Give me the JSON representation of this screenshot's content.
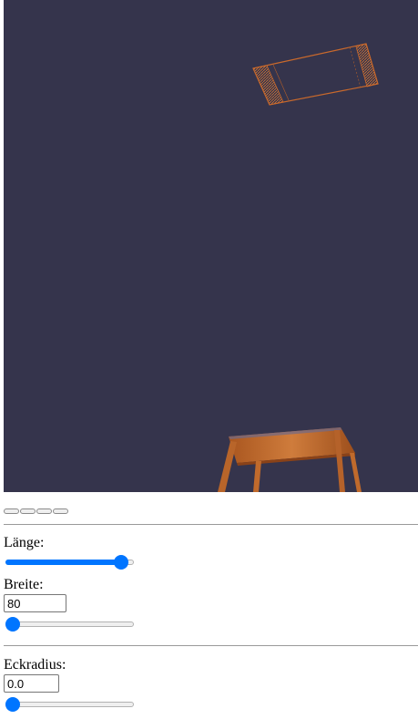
{
  "colors": {
    "scene_background": "#35344c",
    "accent": "#0075ff",
    "wood": "#c06a2c",
    "separator": "#9a9a9a"
  },
  "toolbar": {
    "buttons": [
      "",
      "",
      "",
      ""
    ]
  },
  "controls": {
    "laenge": {
      "label": "Länge:",
      "slider_fraction": 0.95
    },
    "breite": {
      "label": "Breite:",
      "value": "80",
      "slider_fraction": 0.0
    },
    "eckradius": {
      "label": "Eckradius:",
      "value": "0.0",
      "slider_fraction": 0.0
    }
  }
}
